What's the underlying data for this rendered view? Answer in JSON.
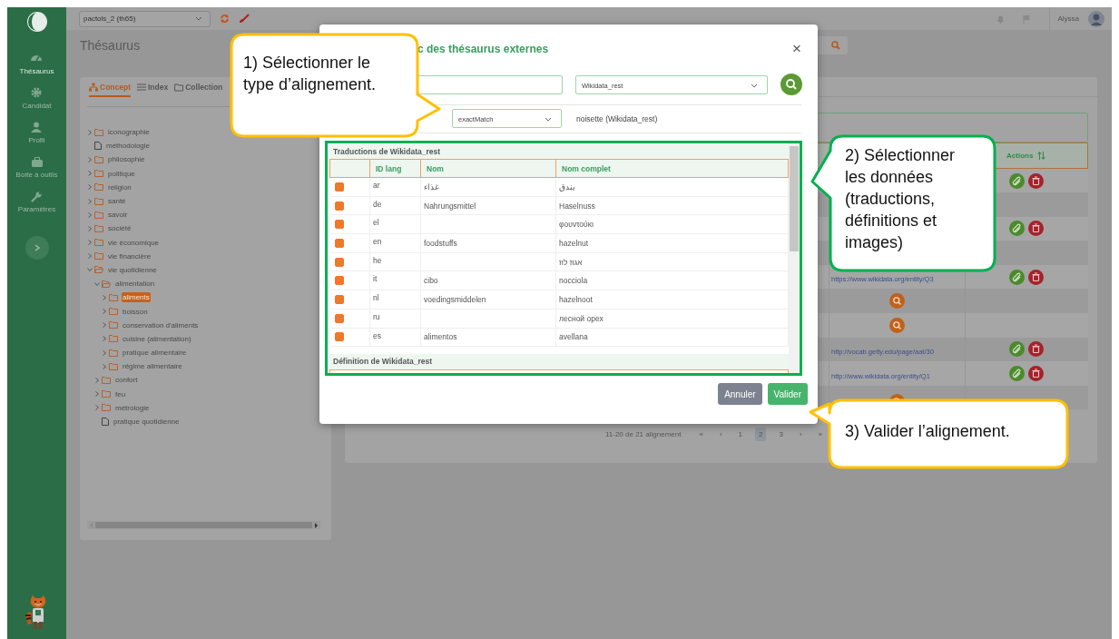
{
  "sidebar": {
    "items": [
      {
        "label": "Thésaurus",
        "selected": true
      },
      {
        "label": "Candidat",
        "selected": false
      },
      {
        "label": "Profil",
        "selected": false
      },
      {
        "label": "Boite à outils",
        "selected": false
      },
      {
        "label": "Paramètres",
        "selected": false
      }
    ]
  },
  "top_bar": {
    "thesaurus_select": "pactols_2 (th65)",
    "user_name": "Alyssa"
  },
  "page_title": "Thésaurus",
  "left_panel": {
    "tabs": [
      {
        "label": "Concept",
        "selected": true
      },
      {
        "label": "Index",
        "selected": false
      },
      {
        "label": "Collection",
        "selected": false
      }
    ],
    "tree": [
      {
        "label": "iconographie",
        "kind": "folder",
        "expanded": false,
        "selected": false
      },
      {
        "label": "méthodologie",
        "kind": "leaf",
        "selected": false
      },
      {
        "label": "philosophie",
        "kind": "folder",
        "expanded": false,
        "selected": false
      },
      {
        "label": "politique",
        "kind": "folder",
        "expanded": false,
        "selected": false
      },
      {
        "label": "religion",
        "kind": "folder",
        "expanded": false,
        "selected": false
      },
      {
        "label": "santé",
        "kind": "folder",
        "expanded": false,
        "selected": false
      },
      {
        "label": "savoir",
        "kind": "folder",
        "expanded": false,
        "selected": false
      },
      {
        "label": "société",
        "kind": "folder",
        "expanded": false,
        "selected": false
      },
      {
        "label": "vie économique",
        "kind": "folder",
        "expanded": false,
        "selected": false
      },
      {
        "label": "vie financière",
        "kind": "folder",
        "expanded": false,
        "selected": false
      },
      {
        "label": "vie quotidienne",
        "kind": "folder",
        "expanded": true,
        "selected": false,
        "children": [
          {
            "label": "alimentation",
            "kind": "folder",
            "expanded": true,
            "selected": false,
            "children": [
              {
                "label": "aliments",
                "kind": "folder",
                "expanded": false,
                "selected": true
              },
              {
                "label": "boisson",
                "kind": "folder",
                "expanded": false,
                "selected": false
              },
              {
                "label": "conservation d'aliments",
                "kind": "folder",
                "expanded": false,
                "selected": false
              },
              {
                "label": "cuisine (alimentation)",
                "kind": "folder",
                "expanded": false,
                "selected": false
              },
              {
                "label": "pratique alimentaire",
                "kind": "folder",
                "expanded": false,
                "selected": false
              },
              {
                "label": "régime alimentaire",
                "kind": "folder",
                "expanded": false,
                "selected": false
              }
            ]
          },
          {
            "label": "confort",
            "kind": "folder",
            "expanded": false,
            "selected": false
          },
          {
            "label": "feu",
            "kind": "folder",
            "expanded": false,
            "selected": false
          },
          {
            "label": "métrologie",
            "kind": "folder",
            "expanded": false,
            "selected": false
          },
          {
            "label": "pratique quotidienne",
            "kind": "leaf",
            "selected": false
          }
        ]
      }
    ]
  },
  "alignments": {
    "actions_header": "Actions",
    "rows": [
      {
        "kind": "aligned"
      },
      {
        "kind": "none"
      },
      {
        "kind": "aligned"
      },
      {
        "kind": "none"
      },
      {
        "kind": "aligned",
        "link": "https://www.wikidata.org/entity/Q3"
      },
      {
        "kind": "search"
      },
      {
        "kind": "search"
      },
      {
        "kind": "aligned",
        "link": "http://vocab.getty.edu/page/aat/30"
      },
      {
        "kind": "aligned",
        "link": "http://www.wikidata.org/entity/Q1"
      },
      {
        "kind": "search"
      }
    ],
    "pagination": {
      "summary": "11-20 de 21 alignement",
      "first": "«",
      "prev": "‹",
      "pages": [
        {
          "label": "1",
          "selected": false
        },
        {
          "label": "2",
          "selected": true
        },
        {
          "label": "3",
          "selected": false
        }
      ],
      "next": "›",
      "last": "»"
    }
  },
  "modal": {
    "title": "c des thésaurus externes",
    "close": "×",
    "source_select": "Wikidata_rest",
    "alignment_type": "exactMatch",
    "match_label": "noisette (Wikidata_rest)",
    "translations": {
      "title": "Traductions de Wikidata_rest",
      "columns": [
        "ID lang",
        "Nom",
        "Nom complet"
      ],
      "rows": [
        {
          "lang": "ar",
          "name": "غذاء",
          "full_name": "بندق",
          "checked": true
        },
        {
          "lang": "de",
          "name": "Nahrungsmittel",
          "full_name": "Haselnuss",
          "checked": true
        },
        {
          "lang": "el",
          "full_name": "φουντούκι",
          "checked": true
        },
        {
          "lang": "en",
          "name": "foodstuffs",
          "full_name": "hazelnut",
          "checked": true
        },
        {
          "lang": "he",
          "full_name": "אגוז לוז",
          "checked": true
        },
        {
          "lang": "it",
          "name": "cibo",
          "full_name": "nocciola",
          "checked": true
        },
        {
          "lang": "nl",
          "name": "voedingsmiddelen",
          "full_name": "hazelnoot",
          "checked": true
        },
        {
          "lang": "ru",
          "full_name": "лесной орех",
          "checked": true
        },
        {
          "lang": "es",
          "name": "alimentos",
          "full_name": "avellana",
          "checked": true
        }
      ]
    },
    "definitions": {
      "title": "Définition de Wikidata_rest"
    },
    "buttons": [
      {
        "label": "Annuler",
        "kind": "cancel"
      },
      {
        "label": "Valider",
        "kind": "confirm"
      }
    ]
  },
  "callouts": [
    {
      "text": "1) Sélectionner le type d’alignement.",
      "color": "#ffc000"
    },
    {
      "text": "2) Sélectionner les données (traductions, définitions et images)",
      "color": "#00b050"
    },
    {
      "text": "3) Valider l’alignement.",
      "color": "#ffc000"
    }
  ]
}
